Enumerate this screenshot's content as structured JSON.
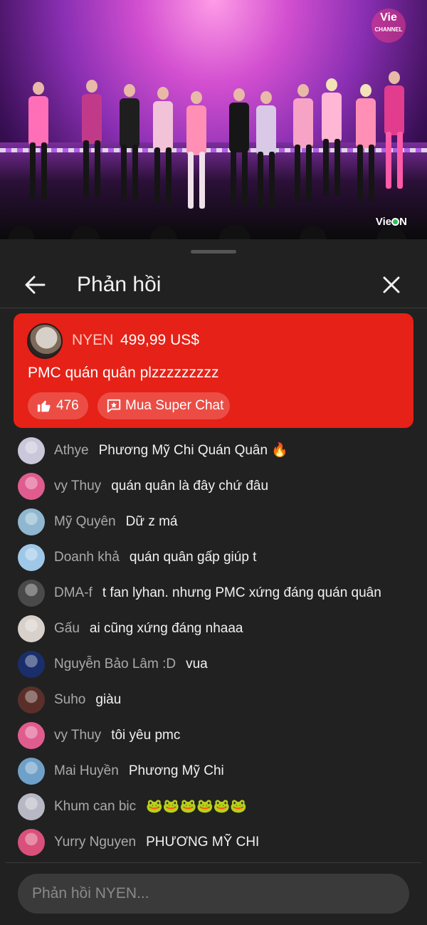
{
  "video": {
    "channel_logo_text": "Vie",
    "channel_logo_sub": "CHANNEL",
    "watermark": "VieON"
  },
  "header": {
    "back_icon": "arrow-left-icon",
    "title": "Phản hồi",
    "close_icon": "close-icon"
  },
  "superchat": {
    "author": "NYEN",
    "amount": "499,99 US$",
    "message": "PMC quán quân plzzzzzzzzz",
    "like_count": "476",
    "buy_label": "Mua Super Chat",
    "background_color": "#e62117"
  },
  "comments": [
    {
      "author": "Athye",
      "text": "Phương Mỹ Chi Quán Quân 🔥",
      "avatar_color": "#c9c7d9"
    },
    {
      "author": "vy Thuy",
      "text": "quán quân là đây chứ đâu",
      "avatar_color": "#e05c8f"
    },
    {
      "author": "Mỹ Quyên",
      "text": "Dữ z má",
      "avatar_color": "#8fb7cf"
    },
    {
      "author": "Doanh khả",
      "text": "quán quân gấp giúp t",
      "avatar_color": "#9fc7e8"
    },
    {
      "author": "DMA-f",
      "text": "t fan lyhan. nhưng PMC xứng đáng quán quân",
      "avatar_color": "#4a4a4a"
    },
    {
      "author": "Gấu",
      "text": "ai cũng xứng đáng nhaaa",
      "avatar_color": "#d8d0cb"
    },
    {
      "author": "Nguyễn Bảo Lâm :D",
      "text": "vua",
      "avatar_color": "#1a2e6b"
    },
    {
      "author": "Suho",
      "text": "giàu",
      "avatar_color": "#5a2f2a"
    },
    {
      "author": "vy Thuy",
      "text": "tôi yêu pmc",
      "avatar_color": "#e05c8f"
    },
    {
      "author": "Mai Huyền",
      "text": "Phương Mỹ Chi",
      "avatar_color": "#6fa0c8"
    },
    {
      "author": "Khum can bic",
      "text": "🐸🐸🐸🐸🐸🐸",
      "avatar_color": "#b8b8c4"
    },
    {
      "author": "Yurry Nguyen",
      "text": "PHƯƠNG MỸ CHI",
      "avatar_color": "#d9507a"
    }
  ],
  "reply": {
    "placeholder": "Phản hồi NYEN..."
  }
}
